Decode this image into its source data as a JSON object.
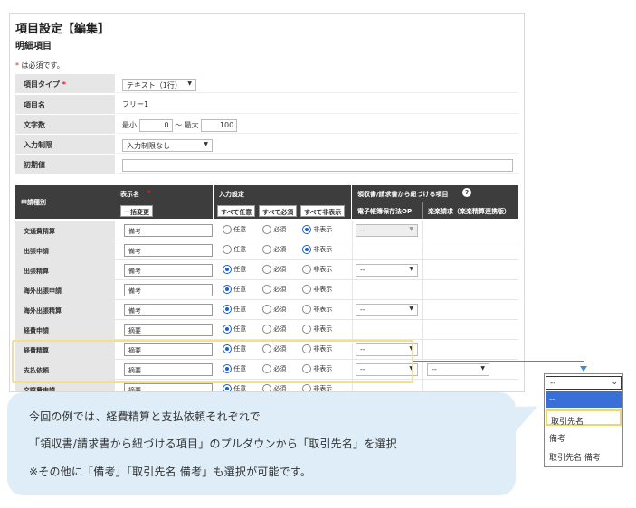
{
  "page": {
    "title": "項目設定【編集】",
    "subtitle": "明細項目",
    "required_note": "は必須です。",
    "required_star": "*"
  },
  "form": {
    "item_type": {
      "label": "項目タイプ",
      "value": "テキスト（1行）"
    },
    "item_name": {
      "label": "項目名",
      "value": "フリー1"
    },
    "char_count": {
      "label": "文字数",
      "min_label": "最小",
      "min_value": "0",
      "sep": "～ 最大",
      "max_value": "100"
    },
    "input_limit": {
      "label": "入力制限",
      "value": "入力制限なし"
    },
    "initial_value": {
      "label": "初期値",
      "value": ""
    }
  },
  "grid": {
    "col_app_type": "申請種別",
    "col_display_name": "表示名",
    "btn_bulk_change": "一括変更",
    "col_input_setting": "入力設定",
    "btn_all_optional": "すべて任意",
    "btn_all_required": "すべて必須",
    "btn_all_hidden": "すべて非表示",
    "col_receipt_link": "領収書/請求書から紐づける項目",
    "col_ebook": "電子帳簿保存法OP",
    "col_rakuraku": "楽楽請求（楽楽精算連携版）",
    "opt_optional": "任意",
    "opt_required": "必須",
    "opt_hidden": "非表示",
    "rows": [
      {
        "label": "交通費精算",
        "text": "備考",
        "selected": "hidden",
        "ebook": "--",
        "ebook_disabled": true,
        "rakuraku": ""
      },
      {
        "label": "出張申請",
        "text": "備考",
        "selected": "hidden",
        "ebook": "",
        "ebook_disabled": false,
        "rakuraku": ""
      },
      {
        "label": "出張精算",
        "text": "備考",
        "selected": "optional",
        "ebook": "--",
        "ebook_disabled": false,
        "rakuraku": ""
      },
      {
        "label": "海外出張申請",
        "text": "備考",
        "selected": "optional",
        "ebook": "",
        "ebook_disabled": false,
        "rakuraku": ""
      },
      {
        "label": "海外出張精算",
        "text": "備考",
        "selected": "optional",
        "ebook": "--",
        "ebook_disabled": false,
        "rakuraku": ""
      },
      {
        "label": "経費申請",
        "text": "摘要",
        "selected": "optional",
        "ebook": "",
        "ebook_disabled": false,
        "rakuraku": ""
      },
      {
        "label": "経費精算",
        "text": "摘要",
        "selected": "optional",
        "ebook": "--",
        "ebook_disabled": false,
        "rakuraku": ""
      },
      {
        "label": "支払依頼",
        "text": "摘要",
        "selected": "optional",
        "ebook": "--",
        "ebook_disabled": false,
        "rakuraku": "--"
      },
      {
        "label": "交際費申請",
        "text": "摘要",
        "selected": "optional",
        "ebook": "",
        "ebook_disabled": false,
        "rakuraku": ""
      }
    ]
  },
  "callout": {
    "line1": "今回の例では、経費精算と支払依頼それぞれで",
    "line2": "「領収書/請求書から紐づける項目」のプルダウンから「取引先名」を選択",
    "line3": "※その他に「備考」「取引先名 備考」も選択が可能です。"
  },
  "dropdown": {
    "current": "--",
    "options": [
      "--",
      "取引先名",
      "備考",
      "取引先名 備考"
    ]
  },
  "colors": {
    "header_bg": "#3d3d3d",
    "highlight": "#f3e08a",
    "callout_bg": "#deedf7",
    "accent_blue": "#3a6fd8"
  }
}
